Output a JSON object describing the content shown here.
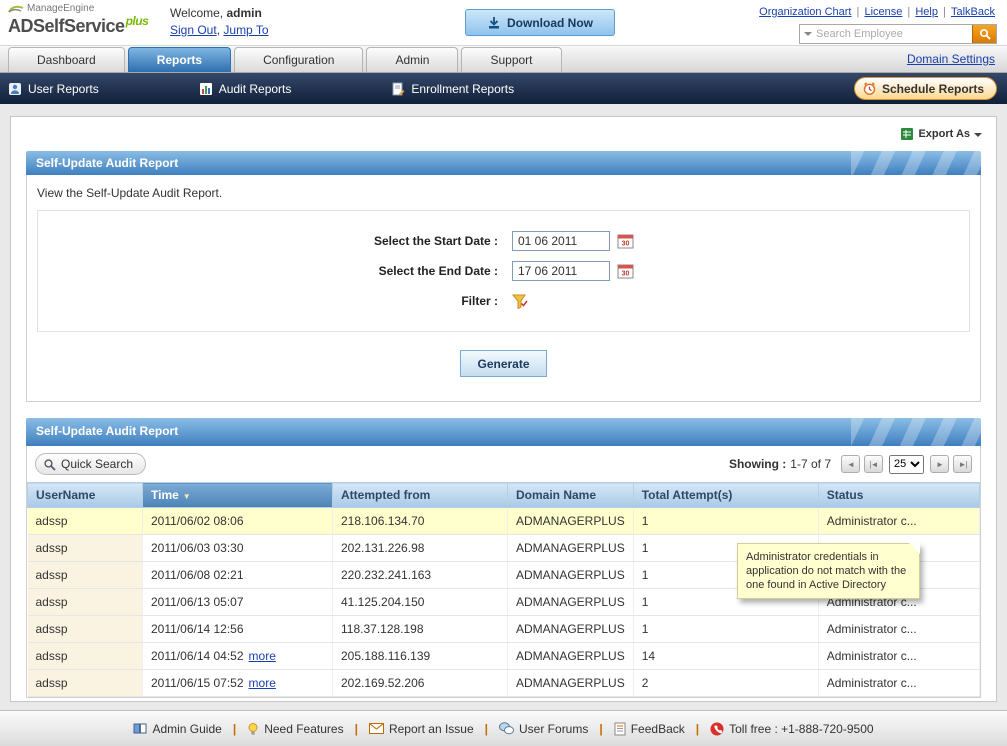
{
  "header": {
    "brand_top": "ManageEngine",
    "brand_main": "ADSelfService",
    "brand_plus": "plus",
    "welcome_label": "Welcome,",
    "username": "admin",
    "sign_out": "Sign Out",
    "jump_to": "Jump To",
    "download_button": "Download Now",
    "top_links": [
      {
        "label": "Organization Chart"
      },
      {
        "label": "License"
      },
      {
        "label": "Help"
      },
      {
        "label": "TalkBack"
      }
    ],
    "search_placeholder": "Search Employee"
  },
  "nav": {
    "tabs": [
      {
        "label": "Dashboard"
      },
      {
        "label": "Reports"
      },
      {
        "label": "Configuration"
      },
      {
        "label": "Admin"
      },
      {
        "label": "Support"
      }
    ],
    "active_tab": "Reports",
    "domain_settings": "Domain Settings"
  },
  "subnav": {
    "items": [
      {
        "label": "User Reports"
      },
      {
        "label": "Audit Reports"
      },
      {
        "label": "Enrollment Reports"
      }
    ],
    "schedule_button": "Schedule Reports"
  },
  "content": {
    "export_label": "Export As"
  },
  "filter_panel": {
    "title": "Self-Update Audit Report",
    "description": "View the Self-Update Audit Report.",
    "start_date_label": "Select the Start Date :",
    "start_date_value": "01 06 2011",
    "end_date_label": "Select the End Date :",
    "end_date_value": "17 06 2011",
    "filter_label": "Filter :",
    "generate_button": "Generate"
  },
  "report": {
    "title": "Self-Update Audit Report",
    "quick_search": "Quick Search",
    "showing_label": "Showing :",
    "showing_range": "1-7 of 7",
    "page_size": "25",
    "columns": [
      "UserName",
      "Time",
      "Attempted from",
      "Domain Name",
      "Total Attempt(s)",
      "Status"
    ],
    "rows": [
      {
        "username": "adssp",
        "time": "2011/06/02 08:06",
        "attempted_from": "218.106.134.70",
        "domain": "ADMANAGERPLUS",
        "attempts": "1",
        "status": "Administrator c..."
      },
      {
        "username": "adssp",
        "time": "2011/06/03 03:30",
        "attempted_from": "202.131.226.98",
        "domain": "ADMANAGERPLUS",
        "attempts": "1",
        "status": "Administrator c..."
      },
      {
        "username": "adssp",
        "time": "2011/06/08 02:21",
        "attempted_from": "220.232.241.163",
        "domain": "ADMANAGERPLUS",
        "attempts": "1",
        "status": "Administrator c..."
      },
      {
        "username": "adssp",
        "time": "2011/06/13 05:07",
        "attempted_from": "41.125.204.150",
        "domain": "ADMANAGERPLUS",
        "attempts": "1",
        "status": "Administrator c..."
      },
      {
        "username": "adssp",
        "time": "2011/06/14 12:56",
        "attempted_from": "118.37.128.198",
        "domain": "ADMANAGERPLUS",
        "attempts": "1",
        "status": "Administrator c..."
      },
      {
        "username": "adssp",
        "time": "2011/06/14 04:52",
        "more": "more",
        "attempted_from": "205.188.116.139",
        "domain": "ADMANAGERPLUS",
        "attempts": "14",
        "status": "Administrator c..."
      },
      {
        "username": "adssp",
        "time": "2011/06/15 07:52",
        "more": "more",
        "attempted_from": "202.169.52.206",
        "domain": "ADMANAGERPLUS",
        "attempts": "2",
        "status": "Administrator c..."
      }
    ],
    "tooltip": "Administrator credentials in application do not match with the one found in Active Directory"
  },
  "footer": {
    "items": [
      {
        "label": "Admin Guide"
      },
      {
        "label": "Need Features"
      },
      {
        "label": "Report an Issue"
      },
      {
        "label": "User Forums"
      },
      {
        "label": "FeedBack"
      },
      {
        "label": "Toll free : +1-888-720-9500"
      }
    ]
  },
  "colors": {
    "accent_blue": "#3f7fbf",
    "navy": "#1d2d4a",
    "highlight_yellow": "#ffffce",
    "orange": "#e8820c"
  }
}
